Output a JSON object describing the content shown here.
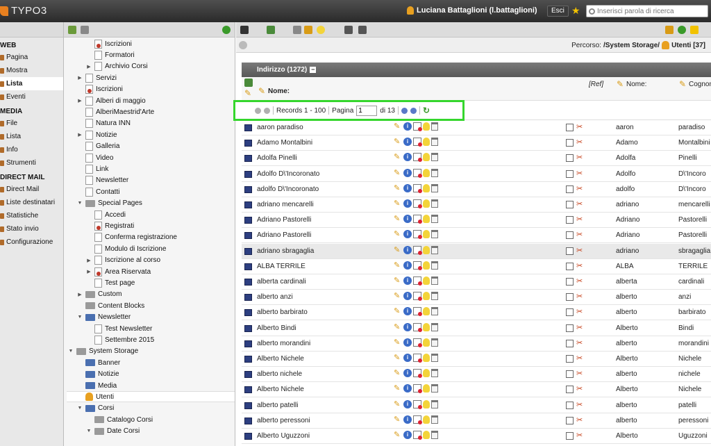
{
  "app": {
    "logo_text": "TYPO3"
  },
  "topbar": {
    "user_name": "Luciana Battaglioni (l.battaglioni)",
    "logout_label": "Esci",
    "search_placeholder": "Inserisci parola di ricerca"
  },
  "modules": [
    {
      "type": "head",
      "label": "WEB"
    },
    {
      "type": "item",
      "label": "Pagina"
    },
    {
      "type": "item",
      "label": "Mostra"
    },
    {
      "type": "item",
      "label": "Lista",
      "active": true
    },
    {
      "type": "item",
      "label": "Eventi"
    },
    {
      "type": "head",
      "label": "MEDIA"
    },
    {
      "type": "item",
      "label": "File"
    },
    {
      "type": "item",
      "label": "Lista"
    },
    {
      "type": "item",
      "label": "Info"
    },
    {
      "type": "item",
      "label": "Strumenti"
    },
    {
      "type": "head",
      "label": "DIRECT MAIL"
    },
    {
      "type": "item",
      "label": "Direct Mail"
    },
    {
      "type": "item",
      "label": "Liste destinatari"
    },
    {
      "type": "item",
      "label": "Statistiche"
    },
    {
      "type": "item",
      "label": "Stato invio"
    },
    {
      "type": "item",
      "label": "Configurazione"
    }
  ],
  "tree": [
    {
      "label": "Iscrizioni",
      "level": 2,
      "icon": "page-red",
      "arrow": ""
    },
    {
      "label": "Formatori",
      "level": 2,
      "icon": "page",
      "arrow": ""
    },
    {
      "label": "Archivio Corsi",
      "level": 2,
      "icon": "page",
      "arrow": "▶"
    },
    {
      "label": "Servizi",
      "level": 1,
      "icon": "page",
      "arrow": "▶"
    },
    {
      "label": "Iscrizioni",
      "level": 1,
      "icon": "page-red",
      "arrow": ""
    },
    {
      "label": "Alberi di maggio",
      "level": 1,
      "icon": "page",
      "arrow": "▶"
    },
    {
      "label": "AlberiMaestrid'Arte",
      "level": 1,
      "icon": "page",
      "arrow": ""
    },
    {
      "label": "Natura INN",
      "level": 1,
      "icon": "page",
      "arrow": ""
    },
    {
      "label": "Notizie",
      "level": 1,
      "icon": "page",
      "arrow": "▶"
    },
    {
      "label": "Galleria",
      "level": 1,
      "icon": "page",
      "arrow": ""
    },
    {
      "label": "Video",
      "level": 1,
      "icon": "page",
      "arrow": ""
    },
    {
      "label": "Link",
      "level": 1,
      "icon": "page",
      "arrow": ""
    },
    {
      "label": "Newsletter",
      "level": 1,
      "icon": "page",
      "arrow": ""
    },
    {
      "label": "Contatti",
      "level": 1,
      "icon": "page",
      "arrow": ""
    },
    {
      "label": "Special Pages",
      "level": 1,
      "icon": "folder",
      "arrow": "▼"
    },
    {
      "label": "Accedi",
      "level": 2,
      "icon": "page",
      "arrow": ""
    },
    {
      "label": "Registrati",
      "level": 2,
      "icon": "page-red",
      "arrow": ""
    },
    {
      "label": "Conferma registrazione",
      "level": 2,
      "icon": "page",
      "arrow": ""
    },
    {
      "label": "Modulo di Iscrizione",
      "level": 2,
      "icon": "page",
      "arrow": ""
    },
    {
      "label": "Iscrizione al corso",
      "level": 2,
      "icon": "page",
      "arrow": "▶"
    },
    {
      "label": "Area Riservata",
      "level": 2,
      "icon": "page-red",
      "arrow": "▶"
    },
    {
      "label": "Test page",
      "level": 2,
      "icon": "page",
      "arrow": ""
    },
    {
      "label": "Custom",
      "level": 1,
      "icon": "folder",
      "arrow": "▶"
    },
    {
      "label": "Content Blocks",
      "level": 1,
      "icon": "folder",
      "arrow": ""
    },
    {
      "label": "Newsletter",
      "level": 1,
      "icon": "folder-blue",
      "arrow": "▼"
    },
    {
      "label": "Test Newsletter",
      "level": 2,
      "icon": "page",
      "arrow": ""
    },
    {
      "label": "Settembre 2015",
      "level": 2,
      "icon": "page",
      "arrow": ""
    },
    {
      "label": "System Storage",
      "level": 0,
      "icon": "folder",
      "arrow": "▼"
    },
    {
      "label": "Banner",
      "level": 1,
      "icon": "folder-blue",
      "arrow": ""
    },
    {
      "label": "Notizie",
      "level": 1,
      "icon": "folder-blue",
      "arrow": ""
    },
    {
      "label": "Media",
      "level": 1,
      "icon": "folder-blue",
      "arrow": ""
    },
    {
      "label": "Utenti",
      "level": 1,
      "icon": "user",
      "arrow": "",
      "selected": true
    },
    {
      "label": "Corsi",
      "level": 1,
      "icon": "folder-blue",
      "arrow": "▼"
    },
    {
      "label": "Catalogo Corsi",
      "level": 2,
      "icon": "folder",
      "arrow": ""
    },
    {
      "label": "Date Corsi",
      "level": 2,
      "icon": "folder",
      "arrow": "▼"
    }
  ],
  "path": {
    "prefix": "Percorso:",
    "text": "/System Storage/",
    "current": "Utenti [37]"
  },
  "panel": {
    "title": "Indirizzo (1272)",
    "name_header": "Nome:",
    "ref_header": "[Ref]",
    "first_header": "Nome:",
    "last_header": "Cognom"
  },
  "pagination": {
    "records": "Records 1 - 100",
    "page_label": "Pagina",
    "page_value": "1",
    "of_label": "di 13"
  },
  "rows": [
    {
      "name": "aaron paradiso",
      "first": "aaron",
      "last": "paradiso"
    },
    {
      "name": "Adamo Montalbini",
      "first": "Adamo",
      "last": "Montalbini"
    },
    {
      "name": "Adolfa Pinelli",
      "first": "Adolfa",
      "last": "Pinelli"
    },
    {
      "name": "Adolfo D\\'Incoronato",
      "first": "Adolfo",
      "last": "D\\'Incoro"
    },
    {
      "name": "adolfo D\\'Incoronato",
      "first": "adolfo",
      "last": "D\\'Incoro"
    },
    {
      "name": "adriano mencarelli",
      "first": "adriano",
      "last": "mencarelli"
    },
    {
      "name": "Adriano Pastorelli",
      "first": "Adriano",
      "last": "Pastorelli"
    },
    {
      "name": "Adriano Pastorelli",
      "first": "Adriano",
      "last": "Pastorelli"
    },
    {
      "name": "adriano sbragaglia",
      "first": "adriano",
      "last": "sbragaglia",
      "hover": true
    },
    {
      "name": "ALBA TERRILE",
      "first": "ALBA",
      "last": "TERRILE"
    },
    {
      "name": "alberta cardinali",
      "first": "alberta",
      "last": "cardinali"
    },
    {
      "name": "alberto anzi",
      "first": "alberto",
      "last": "anzi"
    },
    {
      "name": "alberto barbirato",
      "first": "alberto",
      "last": "barbirato"
    },
    {
      "name": "Alberto Bindi",
      "first": "Alberto",
      "last": "Bindi"
    },
    {
      "name": "alberto morandini",
      "first": "alberto",
      "last": "morandini"
    },
    {
      "name": "Alberto Nichele",
      "first": "Alberto",
      "last": "Nichele"
    },
    {
      "name": "alberto nichele",
      "first": "alberto",
      "last": "nichele"
    },
    {
      "name": "Alberto Nichele",
      "first": "Alberto",
      "last": "Nichele"
    },
    {
      "name": "alberto patelli",
      "first": "alberto",
      "last": "patelli"
    },
    {
      "name": "alberto peressoni",
      "first": "alberto",
      "last": "peressoni"
    },
    {
      "name": "Alberto Uguzzoni",
      "first": "Alberto",
      "last": "Uguzzoni"
    }
  ]
}
